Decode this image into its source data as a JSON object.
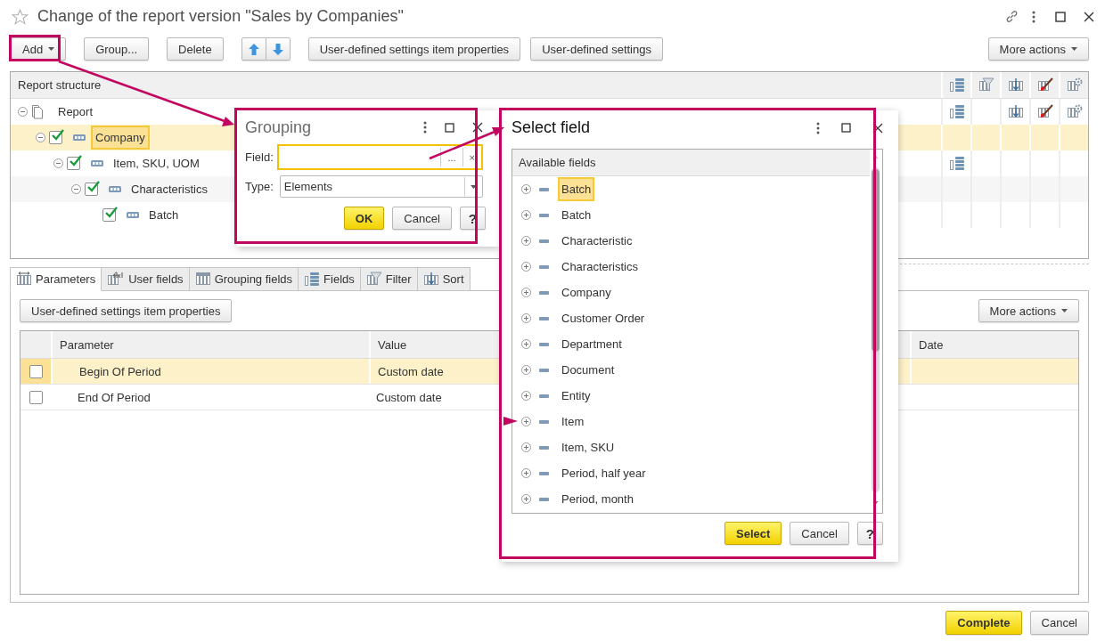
{
  "window": {
    "title": "Change of the report version \"Sales by Companies\""
  },
  "toolbar": {
    "buttons": [
      {
        "label": "Add",
        "kind": "dropdown"
      },
      {
        "label": "Group...",
        "kind": "plain"
      },
      {
        "label": "Delete",
        "kind": "plain"
      },
      {
        "kind": "updown"
      },
      {
        "label": "User-defined settings item properties",
        "kind": "plain"
      },
      {
        "label": "User-defined settings",
        "kind": "plain"
      }
    ],
    "more": "More actions"
  },
  "structure": {
    "header": "Report structure",
    "tree": [
      {
        "label": "Report",
        "kind": "report",
        "expanded": true,
        "selected": false,
        "flags": [
          true,
          false,
          true,
          true,
          true
        ],
        "children": [
          {
            "label": "Company",
            "kind": "grouping",
            "checked": true,
            "expanded": true,
            "selected": true,
            "flags": [
              false,
              false,
              false,
              false,
              false
            ],
            "children": [
              {
                "label": "Item, SKU, UOM",
                "kind": "grouping",
                "checked": true,
                "expanded": true,
                "selected": false,
                "flags": [
                  true,
                  false,
                  false,
                  false,
                  false
                ],
                "children": [
                  {
                    "label": "Characteristics",
                    "kind": "grouping",
                    "checked": true,
                    "expanded": true,
                    "selected": false,
                    "flags": [
                      false,
                      false,
                      false,
                      false,
                      false
                    ],
                    "children": [
                      {
                        "label": "Batch",
                        "kind": "grouping",
                        "checked": true,
                        "selected": false,
                        "flags": [
                          false,
                          false,
                          false,
                          false,
                          false
                        ]
                      }
                    ]
                  }
                ]
              }
            ]
          }
        ]
      }
    ]
  },
  "tabs": [
    {
      "label": "Parameters",
      "selected": true
    },
    {
      "label": "User fields",
      "selected": false
    },
    {
      "label": "Grouping fields",
      "selected": false
    },
    {
      "label": "Fields",
      "selected": false
    },
    {
      "label": "Filter",
      "selected": false
    },
    {
      "label": "Sort",
      "selected": false
    }
  ],
  "parameters": {
    "button": "User-defined settings item properties",
    "more": "More actions",
    "columns": [
      "Parameter",
      "Value",
      "Date"
    ],
    "rows": [
      {
        "checked": false,
        "selected": true,
        "parameter": "Begin Of Period",
        "value": "Custom date"
      },
      {
        "checked": false,
        "selected": false,
        "parameter": "End Of Period",
        "value": "Custom date"
      }
    ]
  },
  "footer": {
    "buttons": [
      {
        "label": "Complete",
        "kind": "default"
      },
      {
        "label": "Cancel",
        "kind": "plain"
      }
    ]
  },
  "grouping_dialog": {
    "title": "Grouping",
    "field_label": "Field:",
    "choose": "...",
    "clear": "×",
    "type_label": "Type:",
    "type_value": "Elements",
    "buttons": [
      {
        "label": "OK",
        "kind": "default"
      },
      {
        "label": "Cancel",
        "kind": "plain"
      },
      {
        "label": "?",
        "kind": "help"
      }
    ]
  },
  "select_dialog": {
    "title": "Select field",
    "header": "Available fields",
    "items": [
      {
        "label": "Batch",
        "selected": true,
        "expanded": false
      },
      {
        "label": "Batch",
        "selected": false,
        "expanded": false
      },
      {
        "label": "Characteristic",
        "selected": false,
        "expanded": false
      },
      {
        "label": "Characteristics",
        "selected": false,
        "expanded": false
      },
      {
        "label": "Company",
        "selected": false,
        "expanded": false
      },
      {
        "label": "Customer Order",
        "selected": false,
        "expanded": false
      },
      {
        "label": "Department",
        "selected": false,
        "expanded": false
      },
      {
        "label": "Document",
        "selected": false,
        "expanded": false
      },
      {
        "label": "Entity",
        "selected": false,
        "expanded": false
      },
      {
        "label": "Item",
        "selected": false,
        "expanded": false
      },
      {
        "label": "Item, SKU",
        "selected": false,
        "expanded": false
      },
      {
        "label": "Period, half year",
        "selected": false,
        "expanded": false
      },
      {
        "label": "Period, month",
        "selected": false,
        "expanded": false
      }
    ],
    "buttons": [
      {
        "label": "Select",
        "kind": "default"
      },
      {
        "label": "Cancel",
        "kind": "plain"
      },
      {
        "label": "?",
        "kind": "help"
      }
    ]
  }
}
